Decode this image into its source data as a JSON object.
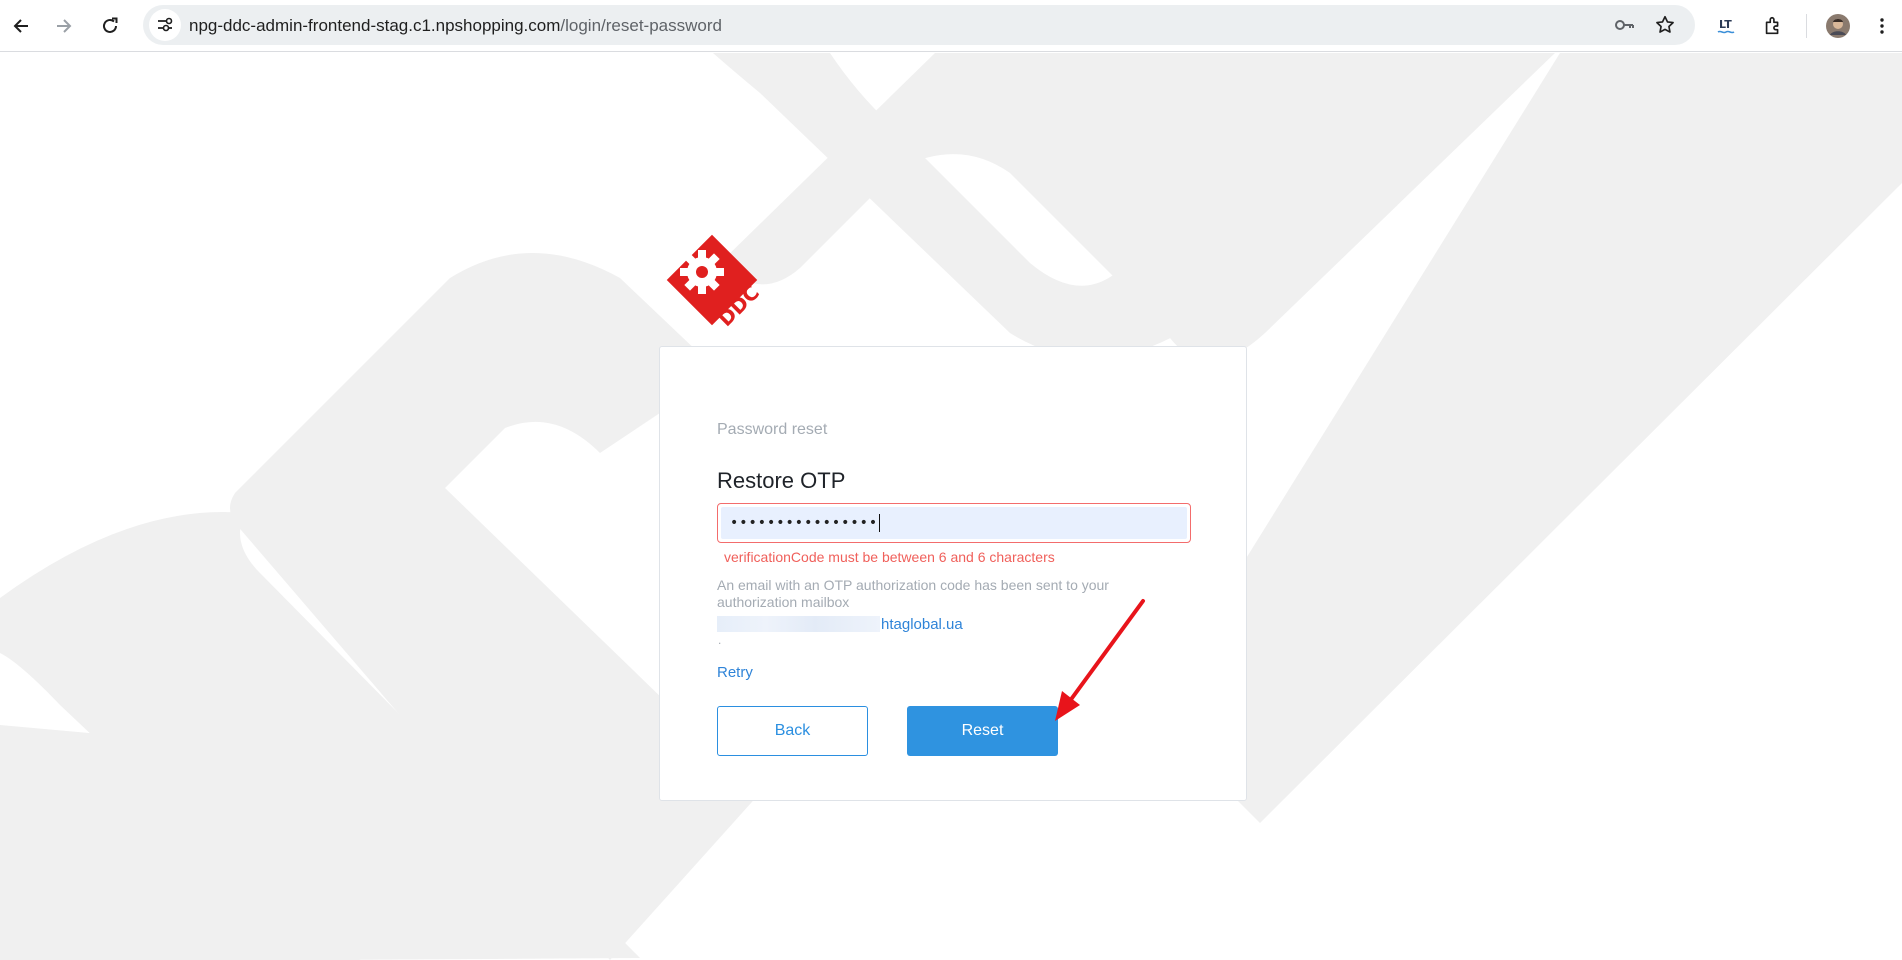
{
  "browser": {
    "url_host": "npg-ddc-admin-frontend-stag.c1.npshopping.com",
    "url_path": "/login/reset-password",
    "icons": [
      "back-icon",
      "forward-icon",
      "reload-icon",
      "site-info-icon",
      "password-key-icon",
      "bookmark-star-icon",
      "languagetool-icon",
      "extensions-icon",
      "profile-avatar",
      "more-menu-icon"
    ],
    "extension_label": "LT"
  },
  "logo": {
    "text": "DDC",
    "color": "#e0201f"
  },
  "form": {
    "subtitle": "Password reset",
    "title": "Restore OTP",
    "otp_value": "••••••••••••••••",
    "error": "verificationCode must be between 6 and 6 characters",
    "info": "An email with an OTP authorization code has been sent to your authorization mailbox",
    "email_suffix": "htaglobal.ua",
    "dot": ".",
    "retry": "Retry",
    "back_button": "Back",
    "reset_button": "Reset"
  },
  "colors": {
    "accent": "#2f93e0",
    "error": "#f0605b",
    "annotation_arrow": "#e8141b"
  }
}
